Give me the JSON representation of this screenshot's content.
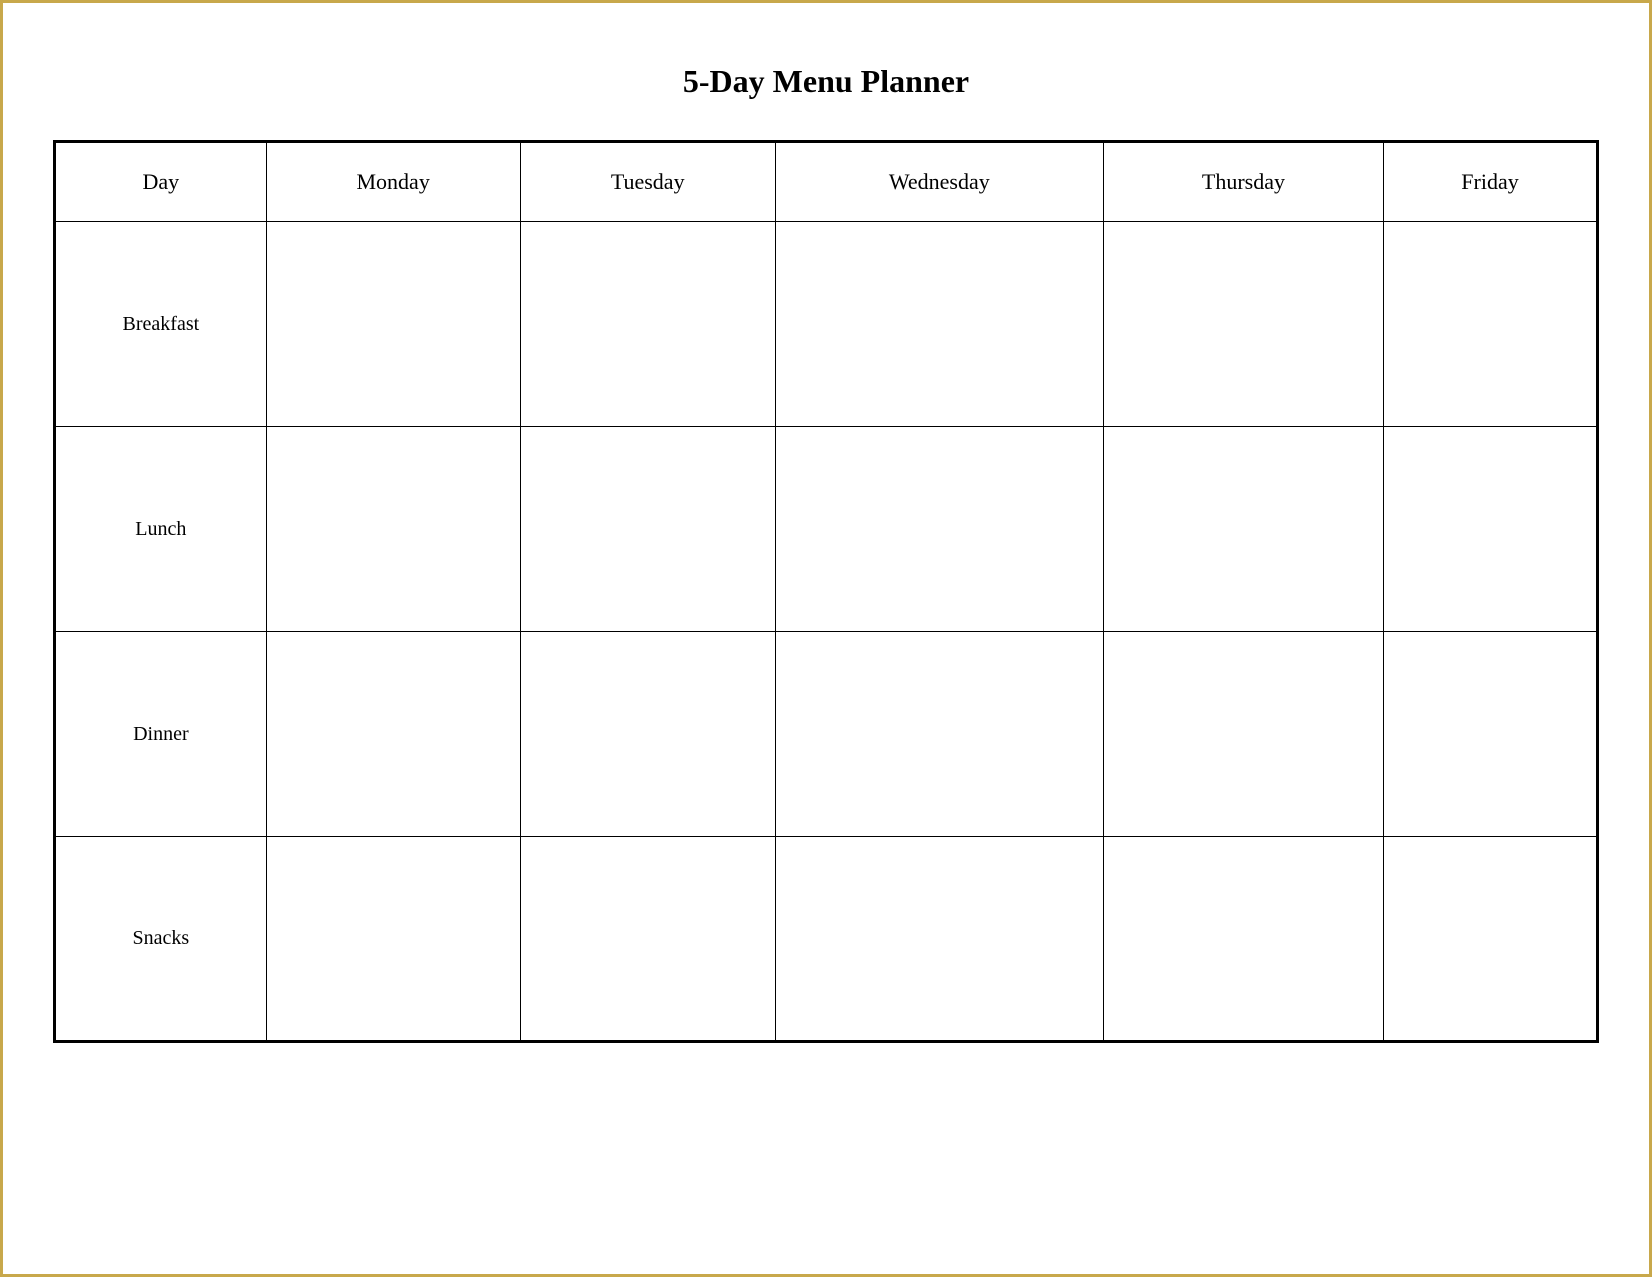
{
  "title": "5-Day Menu Planner",
  "table": {
    "headers": [
      "Day",
      "Monday",
      "Tuesday",
      "Wednesday",
      "Thursday",
      "Friday"
    ],
    "rows": [
      {
        "label": "Breakfast"
      },
      {
        "label": "Lunch"
      },
      {
        "label": "Dinner"
      },
      {
        "label": "Snacks"
      }
    ]
  }
}
